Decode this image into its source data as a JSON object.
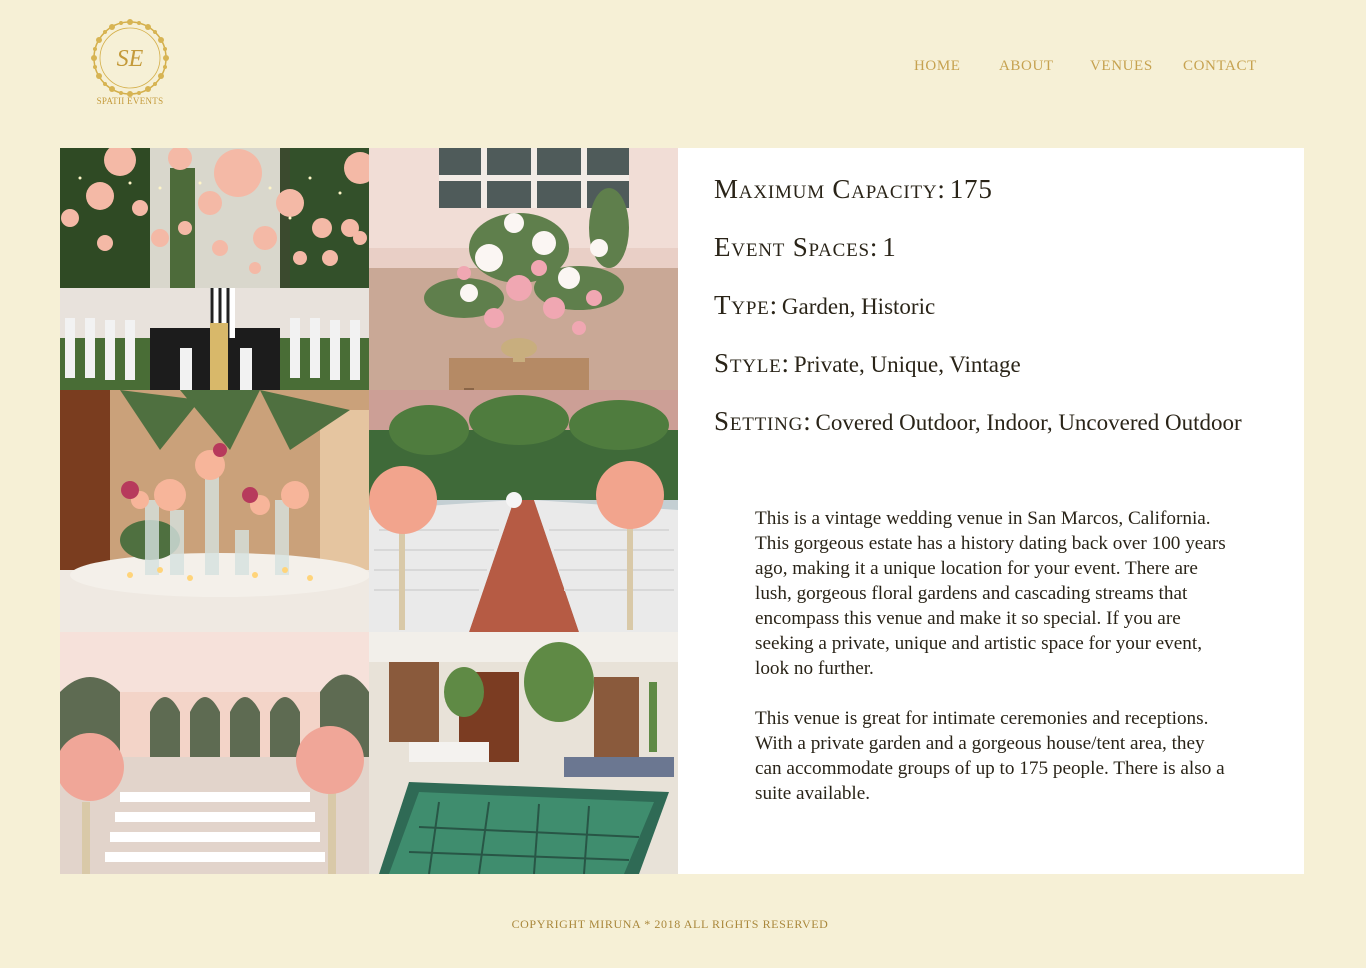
{
  "brand": {
    "monogram": "SE",
    "name": "Spatii Events",
    "color": "#c49a3a"
  },
  "nav": {
    "items": [
      {
        "label": "HOME"
      },
      {
        "label": "ABOUT"
      },
      {
        "label": "VENUES"
      },
      {
        "label": "CONTACT"
      }
    ],
    "color": "#c6a250"
  },
  "gallery": {
    "photos": [
      {
        "name": "pink-lanterns-dinner-photo"
      },
      {
        "name": "floral-arrangement-photo"
      },
      {
        "name": "tall-vase-centerpieces-photo"
      },
      {
        "name": "brick-aisle-ceremony-photo"
      },
      {
        "name": "arches-ceremony-photo"
      },
      {
        "name": "courtyard-pool-photo"
      }
    ]
  },
  "venue": {
    "capacity_label": "Maximum Capacity:",
    "capacity_value": "175",
    "spaces_label": "Event Spaces:",
    "spaces_value": "1",
    "type_label": "Type:",
    "type_value": "Garden, Historic",
    "style_label": "Style:",
    "style_value": "Private, Unique, Vintage",
    "setting_label": "Setting:",
    "setting_value": "Covered Outdoor, Indoor, Uncovered Outdoor",
    "description_1": "This is a vintage wedding venue in San Marcos, California. This gorgeous estate has a history dating back over 100 years ago, making it a unique location for your event. There are lush, gorgeous floral gardens and cascading streams that encompass this venue and make it so special. If  you are seeking a private, unique and artistic space for your event,  look no further.",
    "description_2": "This venue is great for intimate ceremonies and receptions. With a private garden and a gorgeous house/tent area, they can accommodate groups of  up to 175 people. There is also a suite available."
  },
  "footer": {
    "copyright": "copyright miruna * 2018 all rights reserved"
  },
  "colors": {
    "background": "#f6f0d6",
    "panel": "#ffffff",
    "text": "#2a2418",
    "gold": "#c6a250"
  }
}
